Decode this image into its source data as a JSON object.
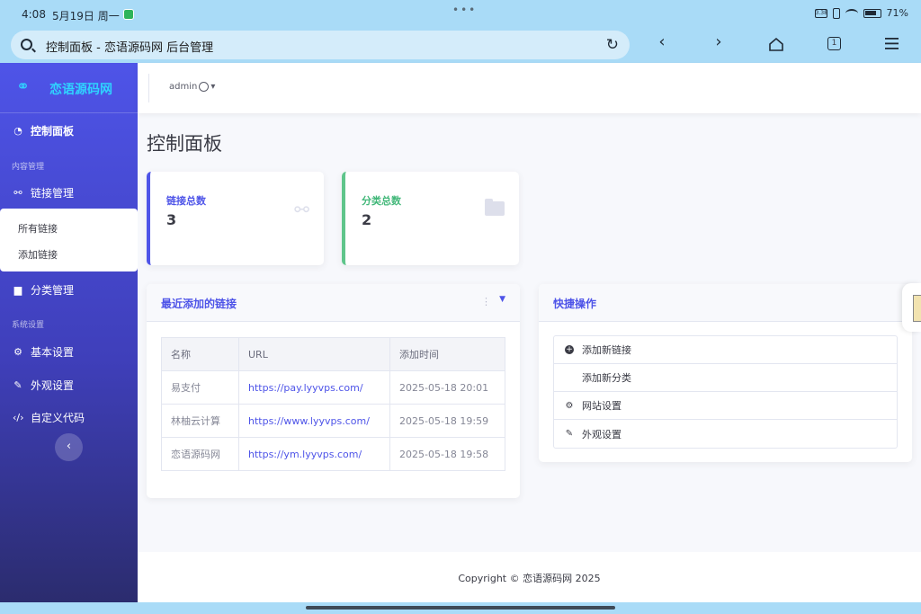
{
  "status_bar": {
    "time": "4:08",
    "date": "5月19日 周一",
    "dots": "•••",
    "signal_text": "3.38",
    "battery": "71%"
  },
  "browser": {
    "url_text": "控制面板 - 恋语源码网 后台管理",
    "back_icon": "‹",
    "forward_icon": "›",
    "tab_count": "1"
  },
  "sidebar": {
    "brand": "恋语源码网",
    "dashboard": "控制面板",
    "section_content": "内容管理",
    "links_manage": "链接管理",
    "all_links": "所有链接",
    "add_link": "添加链接",
    "category_manage": "分类管理",
    "section_system": "系统设置",
    "basic_settings": "基本设置",
    "appearance": "外观设置",
    "custom_code": "自定义代码",
    "toggle_icon": "‹"
  },
  "topbar": {
    "username": "admin"
  },
  "main": {
    "page_title": "控制面板",
    "stats": [
      {
        "label": "链接总数",
        "value": "3"
      },
      {
        "label": "分类总数",
        "value": "2"
      }
    ],
    "recent": {
      "title": "最近添加的链接",
      "columns": [
        "名称",
        "URL",
        "添加时间"
      ],
      "rows": [
        {
          "name": "易支付",
          "url": "https://pay.lyyvps.com/",
          "time": "2025-05-18 20:01"
        },
        {
          "name": "林柚云计算",
          "url": "https://www.lyyvps.com/",
          "time": "2025-05-18 19:59"
        },
        {
          "name": "恋语源码网",
          "url": "https://ym.lyyvps.com/",
          "time": "2025-05-18 19:58"
        }
      ]
    },
    "quick": {
      "title": "快捷操作",
      "items": [
        "添加新链接",
        "添加新分类",
        "网站设置",
        "外观设置"
      ]
    }
  },
  "footer": {
    "copyright": "Copyright © 恋语源码网 2025"
  },
  "colors": {
    "primary": "#4e54e8",
    "success": "#5fc58b",
    "browser_bar": "#a9dbf7"
  }
}
